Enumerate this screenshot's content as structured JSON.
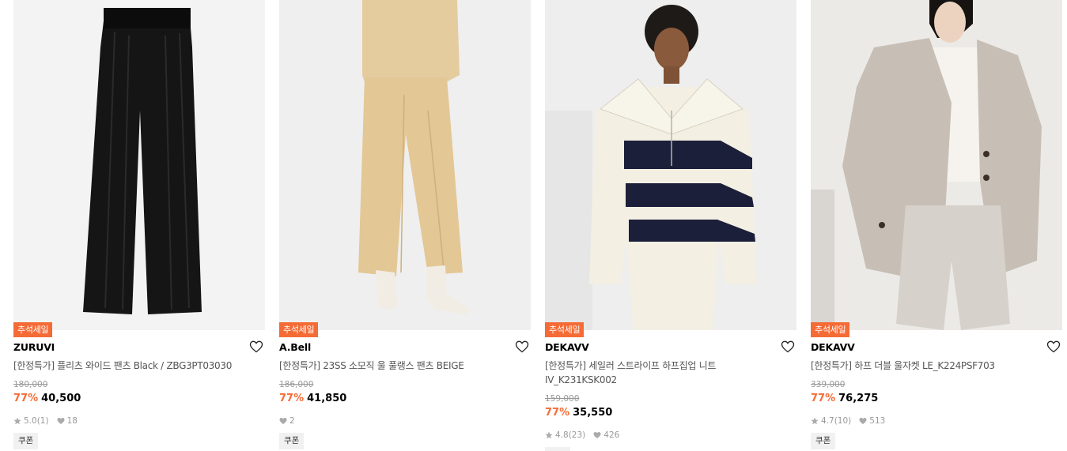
{
  "products": [
    {
      "badge": "추석세일",
      "brand": "ZURUVI",
      "name": "[한정특가] 플리츠 와이드 팬츠 Black / ZBG3PT03030",
      "original_price": "180,000",
      "discount": "77%",
      "price": "40,500",
      "rating": "5.0",
      "review_count": "(1)",
      "likes": "18",
      "coupon": "쿠폰",
      "image_icon": "black-wide-pants-photo"
    },
    {
      "badge": "추석세일",
      "brand": "A.Bell",
      "name": "[한정특가] 23SS 소모직 울 풀랭스 팬츠 BEIGE",
      "original_price": "186,000",
      "discount": "77%",
      "price": "41,850",
      "likes": "2",
      "coupon": "쿠폰",
      "image_icon": "beige-pants-photo"
    },
    {
      "badge": "추석세일",
      "brand": "DEKAVV",
      "name": "[한정특가] 세일러 스트라이프 하프집업 니트 IV_K231KSK002",
      "original_price": "159,000",
      "discount": "77%",
      "price": "35,550",
      "rating": "4.8",
      "review_count": "(23)",
      "likes": "426",
      "image_icon": "striped-knit-photo"
    },
    {
      "badge": "추석세일",
      "brand": "DEKAVV",
      "name": "[한정특가] 하프 더블 울자켓 LE_K224PSF703",
      "original_price": "339,000",
      "discount": "77%",
      "price": "76,275",
      "rating": "4.7",
      "review_count": "(10)",
      "likes": "513",
      "coupon": "쿠폰",
      "image_icon": "wool-jacket-photo"
    }
  ],
  "colors": {
    "accent": "#f56b36",
    "text": "#000000",
    "muted": "#999999",
    "coupon_bg": "#f1f1f1"
  }
}
